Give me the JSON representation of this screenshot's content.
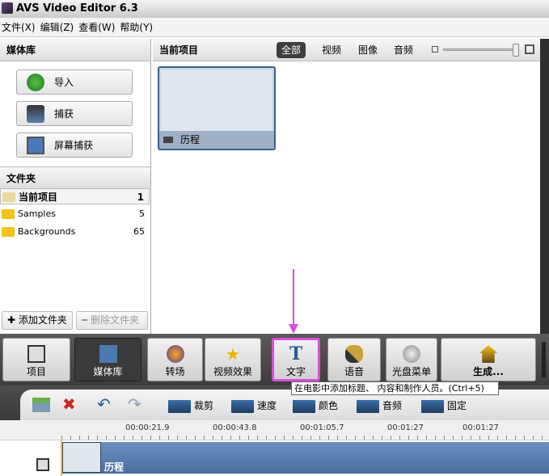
{
  "window": {
    "title": "AVS Video Editor 6.3"
  },
  "menu": [
    "文件(X)",
    "编辑(Z)",
    "查看(W)",
    "帮助(Y)"
  ],
  "library": {
    "title": "媒体库",
    "buttons": [
      "导入",
      "捕获",
      "屏幕捕获"
    ],
    "folders_title": "文件夹",
    "folders": [
      {
        "name": "当前项目",
        "count": "1"
      },
      {
        "name": "Samples",
        "count": "5"
      },
      {
        "name": "Backgrounds",
        "count": "65"
      }
    ],
    "add_folder": "添加文件夹",
    "delete_folder": "删除文件夹"
  },
  "main": {
    "title": "当前项目",
    "filters": [
      "全部",
      "视频",
      "图像",
      "音频"
    ],
    "active_filter": "全部",
    "zoom_level": 0.95,
    "items": [
      {
        "name": "历程"
      }
    ]
  },
  "toolbar": [
    "项目",
    "媒体库",
    "转场",
    "视频效果",
    "文字",
    "语音",
    "光盘菜单",
    "生成..."
  ],
  "active_tool": "媒体库",
  "highlight_color": "#d84fd8",
  "tooltip": "在电影中添加标题、 内容和制作人员。(Ctrl+5)",
  "edit_tools": [
    "裁剪",
    "速度",
    "颜色",
    "音频",
    "固定"
  ],
  "timeline": {
    "ticks": [
      "00:00:21.9",
      "00:00:43.8",
      "00:01:05.7",
      "00:01:27",
      "00:01:27"
    ],
    "clip": "历程"
  }
}
